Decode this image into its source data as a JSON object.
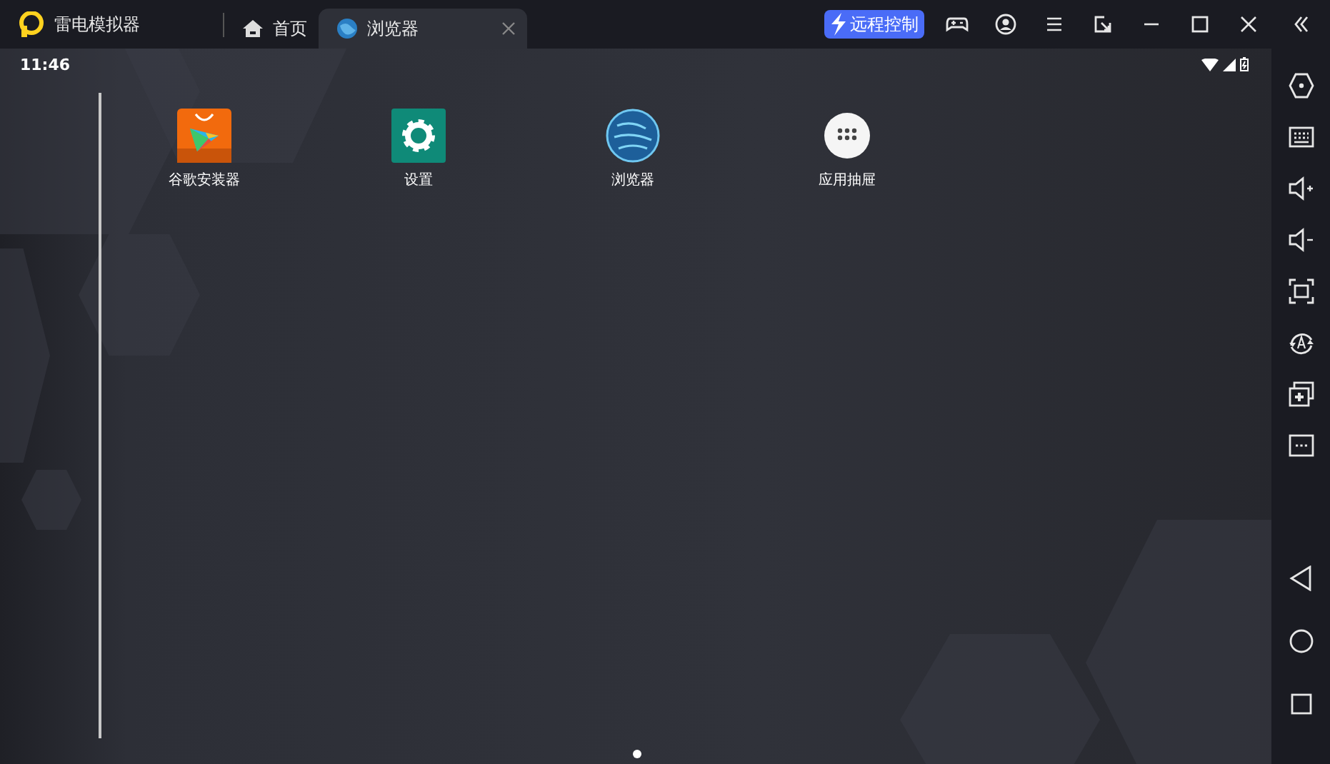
{
  "title_bar": {
    "app_name": "雷电模拟器",
    "tabs": [
      {
        "label": "首页",
        "kind": "home",
        "selected": false
      },
      {
        "label": "浏览器",
        "kind": "browser",
        "selected": true
      }
    ],
    "remote_button": "远程控制"
  },
  "status_bar": {
    "time": "11:46"
  },
  "home_screen": {
    "apps": [
      {
        "label": "谷歌安装器",
        "kind": "store"
      },
      {
        "label": "设置",
        "kind": "settings"
      },
      {
        "label": "浏览器",
        "kind": "browser"
      },
      {
        "label": "应用抽屉",
        "kind": "drawer"
      }
    ],
    "pages": [
      {
        "selected": true
      }
    ]
  }
}
